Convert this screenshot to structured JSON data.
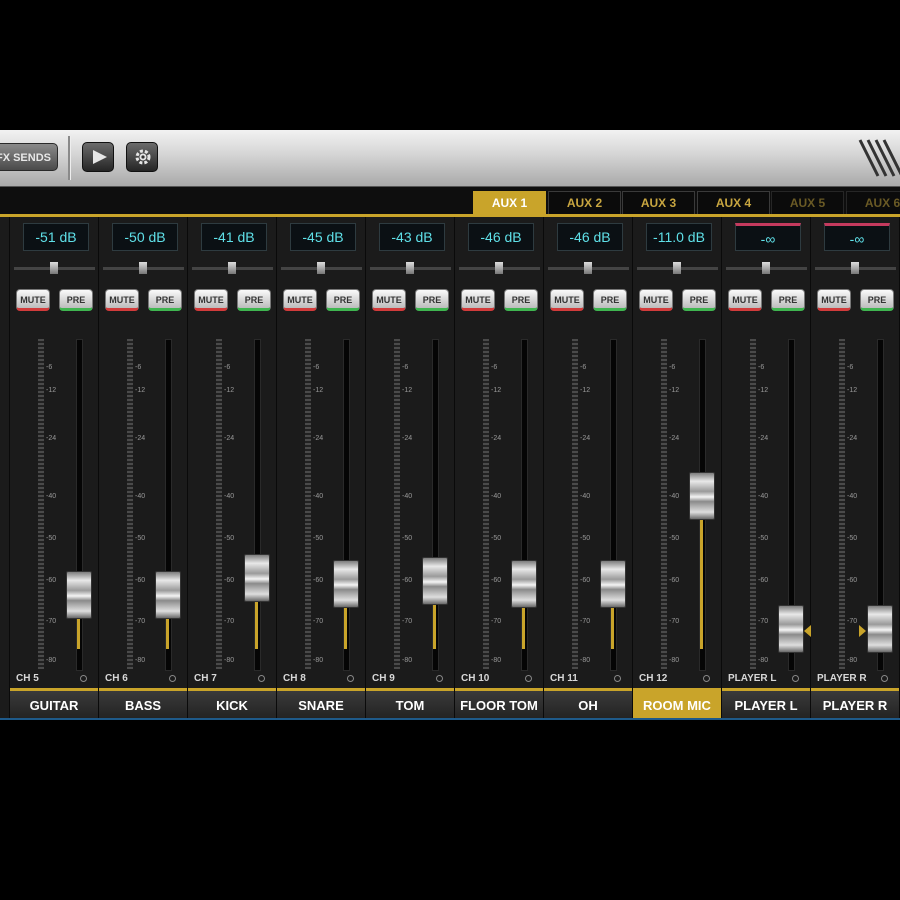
{
  "toolbar": {
    "fx_sends_label": "FX SENDS"
  },
  "aux_tabs": [
    {
      "label": "AUX 1",
      "state": "active"
    },
    {
      "label": "AUX 2",
      "state": "normal"
    },
    {
      "label": "AUX 3",
      "state": "normal"
    },
    {
      "label": "AUX 4",
      "state": "normal"
    },
    {
      "label": "AUX 5",
      "state": "dim"
    },
    {
      "label": "AUX 6",
      "state": "dim"
    }
  ],
  "buttons": {
    "mute": "MUTE",
    "pre": "PRE"
  },
  "scale_labels": [
    "-6",
    "-12",
    "-24",
    "-40",
    "-50",
    "-60",
    "-70",
    "-80"
  ],
  "channels": [
    {
      "ch": "CH 5",
      "name": "GUITAR",
      "level": "-51 dB",
      "fader": 0.12
    },
    {
      "ch": "CH 6",
      "name": "BASS",
      "level": "-50 dB",
      "fader": 0.12
    },
    {
      "ch": "CH 7",
      "name": "KICK",
      "level": "-41 dB",
      "fader": 0.18
    },
    {
      "ch": "CH 8",
      "name": "SNARE",
      "level": "-45 dB",
      "fader": 0.16
    },
    {
      "ch": "CH 9",
      "name": "TOM",
      "level": "-43 dB",
      "fader": 0.17
    },
    {
      "ch": "CH 10",
      "name": "FLOOR TOM",
      "level": "-46 dB",
      "fader": 0.16
    },
    {
      "ch": "CH 11",
      "name": "OH",
      "level": "-46 dB",
      "fader": 0.16
    },
    {
      "ch": "CH 12",
      "name": "ROOM MIC",
      "level": "-11.0 dB",
      "fader": 0.47,
      "active": true
    },
    {
      "ch": "PLAYER L",
      "name": "PLAYER L",
      "level": "-∞",
      "fader": 0.0,
      "marker": "right"
    },
    {
      "ch": "PLAYER R",
      "name": "PLAYER R",
      "level": "-∞",
      "fader": 0.0,
      "marker": "left"
    }
  ]
}
